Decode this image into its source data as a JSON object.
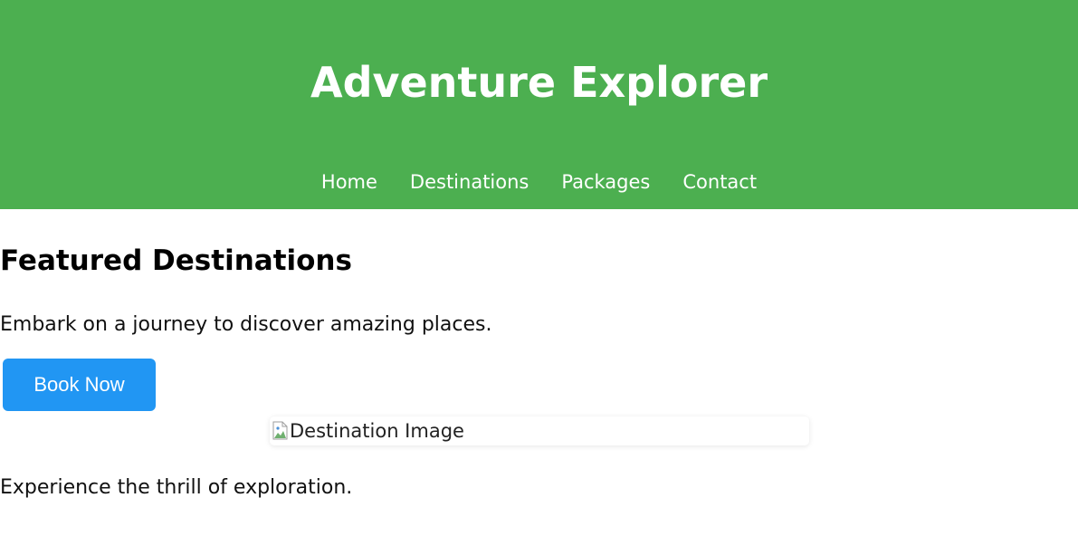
{
  "header": {
    "title": "Adventure Explorer",
    "background_color": "#4caf50",
    "nav": [
      {
        "label": "Home"
      },
      {
        "label": "Destinations"
      },
      {
        "label": "Packages"
      },
      {
        "label": "Contact"
      }
    ]
  },
  "main": {
    "heading": "Featured Destinations",
    "intro": "Embark on a journey to discover amazing places.",
    "cta_label": "Book Now",
    "cta_color": "#2196f3",
    "image_alt": "Destination Image",
    "image_icon": "broken-image-icon",
    "outro": "Experience the thrill of exploration."
  }
}
